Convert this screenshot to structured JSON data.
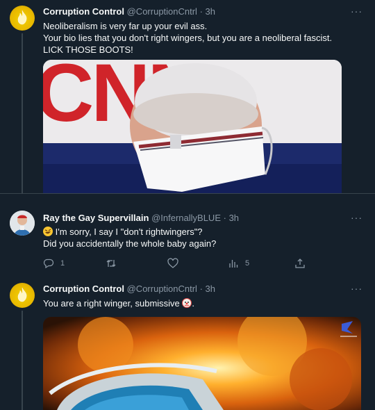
{
  "tweets": [
    {
      "author": "Corruption Control",
      "handle": "@CorruptionCntrl",
      "time": "3h",
      "lines": [
        "Neoliberalism is very far up your evil ass.",
        "Your bio lies that you don't right wingers, but you are a neoliberal fascist.",
        "LICK THOSE BOOTS!"
      ],
      "media_overlay_text": "CNN",
      "avatar_icon": "flame-icon"
    },
    {
      "author": "Ray the Gay Supervillain",
      "handle": "@InfernallyBLUE",
      "time": "3h",
      "lines": [
        "I'm sorry, I say I \"don't rightwingers\"?",
        "Did you accidentally the whole baby again?"
      ],
      "emoji": "rolling-on-floor-laughing-icon",
      "actions": {
        "replies": "1",
        "retweets": "",
        "likes": "",
        "views": "5"
      }
    },
    {
      "author": "Corruption Control",
      "handle": "@CorruptionCntrl",
      "time": "3h",
      "lines": [
        "You are a right winger, submissive",
        "."
      ],
      "emoji": "clown-face-icon",
      "avatar_icon": "flame-icon"
    }
  ],
  "separator": "·",
  "more_label": "···",
  "colors": {
    "background": "#15202b",
    "divider": "#38444d",
    "secondary_text": "#8b98a5",
    "primary_text": "#f7f9f9",
    "cnn_red": "#d0242a"
  }
}
